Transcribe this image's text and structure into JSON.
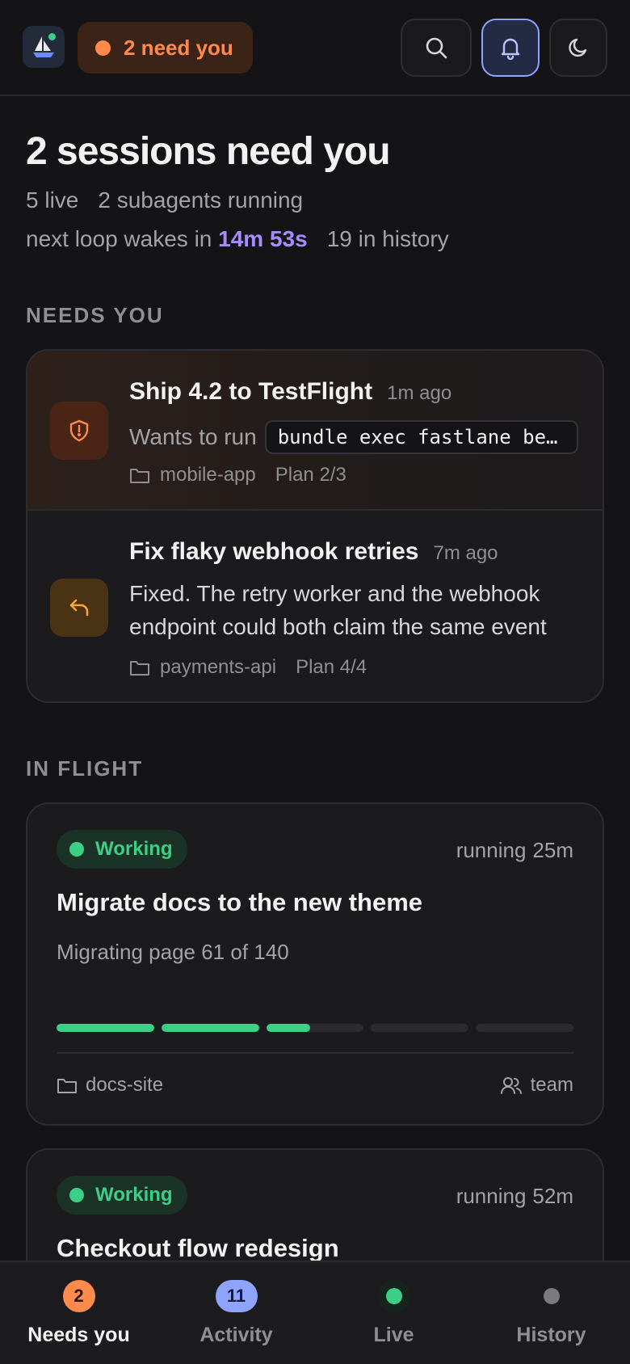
{
  "header": {
    "needs_pill": "2 need you",
    "accent": "#ff8a4c",
    "icons": [
      "sailboat-logo-icon",
      "search-icon",
      "bell-icon",
      "moon-icon"
    ]
  },
  "summary": {
    "title": "2 sessions need you",
    "live": "5 live",
    "subagents": "2 subagents running",
    "loop_prefix": "next loop wakes in",
    "loop_time": "14m 53s",
    "history": "19 in history"
  },
  "needs_you": {
    "label": "NEEDS YOU",
    "items": [
      {
        "title": "Ship 4.2 to TestFlight",
        "ago": "1m ago",
        "wants_prefix": "Wants to run",
        "command": "bundle exec fastlane beta",
        "repo": "mobile-app",
        "plan": "Plan 2/3",
        "icon": "shield-alert-icon"
      },
      {
        "title": "Fix flaky webhook retries",
        "ago": "7m ago",
        "excerpt_line1": "Fixed. The retry worker and the webhook",
        "excerpt_line2": "endpoint could both claim the same event",
        "repo": "payments-api",
        "plan": "Plan 4/4",
        "icon": "reply-icon"
      }
    ]
  },
  "in_flight": {
    "label": "IN FLIGHT",
    "items": [
      {
        "status": "Working",
        "running_label": "running",
        "running_time": "25m",
        "title": "Migrate docs to the new theme",
        "subtitle": "Migrating page 61 of 140",
        "progress_segments": [
          1,
          1,
          0.45,
          0,
          0
        ],
        "repo": "docs-site",
        "owner": "team"
      },
      {
        "status": "Working",
        "running_label": "running",
        "running_time": "52m",
        "title": "Checkout flow redesign"
      }
    ]
  },
  "bottom_nav": [
    {
      "label": "Needs you",
      "badge": "2",
      "active": true
    },
    {
      "label": "Activity",
      "badge": "11"
    },
    {
      "label": "Live"
    },
    {
      "label": "History"
    }
  ]
}
